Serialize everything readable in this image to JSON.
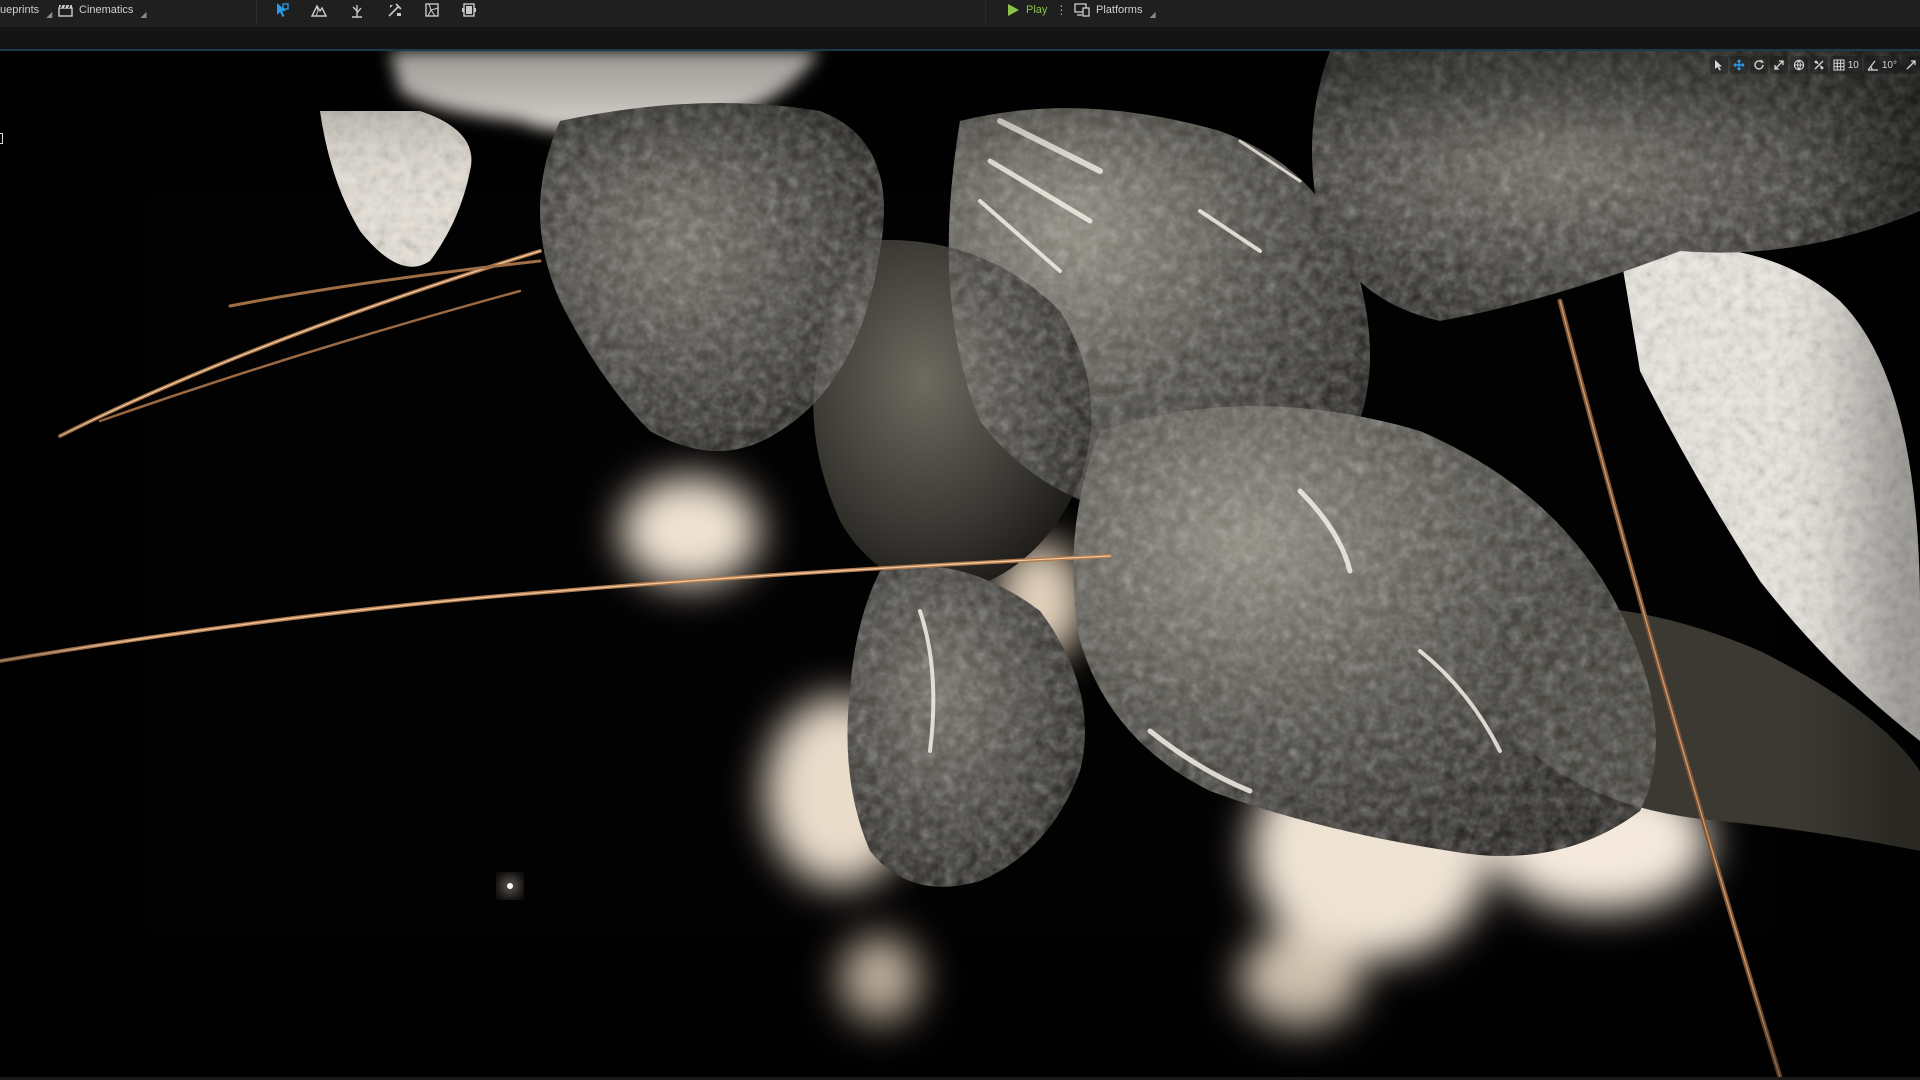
{
  "toolbar": {
    "blueprints_label": "ueprints",
    "cinematics_label": "Cinematics",
    "play_label": "Play",
    "play_more": "⋮",
    "platforms_label": "Platforms"
  },
  "viewport_tools": {
    "grid_snap_value": "10",
    "angle_snap_value": "10°"
  },
  "colors": {
    "toolbar_bg": "#1f1f1f",
    "accent_blue": "#2a9dea",
    "play_green": "#8bc34a",
    "viewport_bg": "#030202"
  },
  "icons": [
    "blueprints-icon",
    "cinematics-clapper-icon",
    "select-mode-icon",
    "landscape-mode-icon",
    "foliage-mode-icon",
    "mesh-paint-mode-icon",
    "fracture-mode-icon",
    "modeling-mode-icon",
    "play-icon",
    "platforms-icon",
    "select-tool-icon",
    "translate-tool-icon",
    "rotate-tool-icon",
    "scale-tool-icon",
    "world-space-icon",
    "surface-snap-icon",
    "grid-snap-icon",
    "angle-snap-icon",
    "maximize-viewport-icon"
  ]
}
